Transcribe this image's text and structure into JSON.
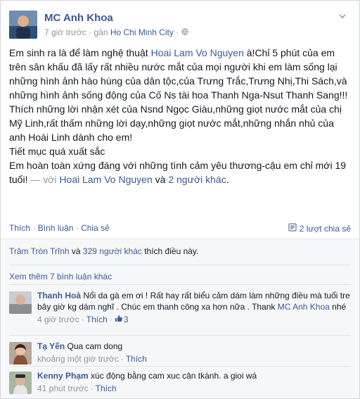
{
  "post": {
    "author": "MC Anh Khoa",
    "time": "7 giờ trước",
    "location_prefix": "gần",
    "location": "Ho Chi Minh City",
    "text": {
      "p1a": "Em sinh ra là để làm nghệ thuật ",
      "tag1": "Hoai Lam Vo Nguyen",
      "p1b": " à!Chỉ 5 phút của em trên sân khấu đã lấy rất nhiều nước mắt của mọi người khi em làm sống lại những hình ảnh hào hùng của dân tộc,của Trưng Trắc,Trưng Nhị,Thi Sách,và những hình ảnh sống động của Cố Ns tài hoa Thanh Nga-Nsut Thanh Sang!!!",
      "p2": "Thích những lời nhận xét của Nsnd Ngọc Giàu,những giọt nước mắt của chị Mỹ Linh,rất thấm những lời dạy,những giọt nước mắt,những nhắn nhủ của anh Hoài Linh dành cho em!",
      "p3": "Tiết mục quá xuất sắc",
      "p4": "Em hoàn toàn xứng đáng với những tình cảm yêu thương-cậu em chỉ mới 19 tuổi!",
      "with_prefix": " — với ",
      "tag2": "Hoai Lam Vo Nguyen",
      "and": " và ",
      "others": "2 người khác",
      "end": "."
    }
  },
  "actions": {
    "like": "Thích",
    "comment": "Bình luận",
    "share": "Chia sẻ",
    "share_count": "2 lượt chia sẻ"
  },
  "likes": {
    "names": "Trâm Tròn Trĩnh",
    "connector": " và ",
    "others": "329 người khác",
    "suffix": " thích điều này."
  },
  "more_comments": "Xem thêm 7 bình luận khác",
  "comments": [
    {
      "name": "Thanh Hoà",
      "text": "Nổi da gà em ơi ! Rất hay rất biểu cảm dám làm những điều mà tuổi tre bây giờ kg dám nghĩ . Chúc em thanh công xa hơn nữa . Thank ",
      "mention": "MC Anh Khoa",
      "tail": " nhé",
      "time": "4 giờ trước",
      "like": "Thích",
      "like_count": "3"
    },
    {
      "name": "Tạ Yến",
      "text": "Qua cam dong",
      "time": "khoảng một giờ trước",
      "like": "Thích"
    },
    {
      "name": "Kenny Phạm",
      "text": "xúc động bằng cam xuc cân tkành. a gioi wá",
      "time": "41 phút trước",
      "like": "Thích"
    }
  ],
  "colors": {
    "link": "#3b5998",
    "muted": "#90949c",
    "text": "#141823"
  },
  "icons": [
    "chevron-down-icon",
    "globe-icon",
    "share-icon",
    "thumbs-up-icon"
  ]
}
